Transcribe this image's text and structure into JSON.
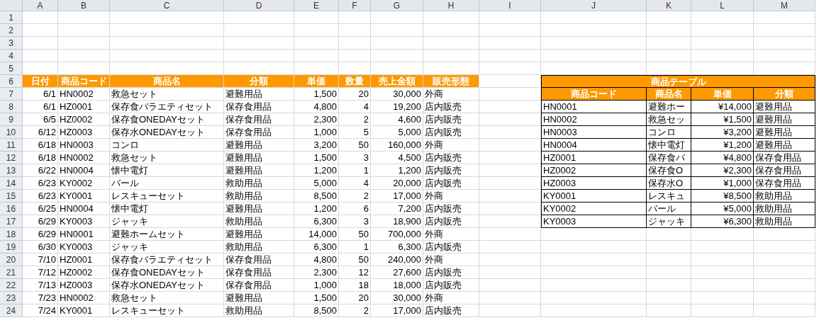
{
  "column_headers": [
    "A",
    "B",
    "C",
    "D",
    "E",
    "F",
    "G",
    "H",
    "I",
    "J",
    "K",
    "L",
    "M"
  ],
  "row_numbers": [
    "1",
    "2",
    "3",
    "4",
    "5",
    "6",
    "7",
    "8",
    "9",
    "10",
    "11",
    "12",
    "13",
    "14",
    "15",
    "16",
    "17",
    "18",
    "19",
    "20",
    "21",
    "22",
    "23",
    "24"
  ],
  "sales_table": {
    "headers": [
      "日付",
      "商品コード",
      "商品名",
      "分類",
      "単価",
      "数量",
      "売上金額",
      "販売形態"
    ],
    "rows": [
      {
        "date": "6/1",
        "code": "HN0002",
        "name": "救急セット",
        "category": "避難用品",
        "unit_price": "1,500",
        "quantity": "20",
        "amount": "30,000",
        "sales_type": "外商"
      },
      {
        "date": "6/1",
        "code": "HZ0001",
        "name": "保存食バラエティセット",
        "category": "保存食用品",
        "unit_price": "4,800",
        "quantity": "4",
        "amount": "19,200",
        "sales_type": "店内販売"
      },
      {
        "date": "6/5",
        "code": "HZ0002",
        "name": "保存食ONEDAYセット",
        "category": "保存食用品",
        "unit_price": "2,300",
        "quantity": "2",
        "amount": "4,600",
        "sales_type": "店内販売"
      },
      {
        "date": "6/12",
        "code": "HZ0003",
        "name": "保存水ONEDAYセット",
        "category": "保存食用品",
        "unit_price": "1,000",
        "quantity": "5",
        "amount": "5,000",
        "sales_type": "店内販売"
      },
      {
        "date": "6/18",
        "code": "HN0003",
        "name": "コンロ",
        "category": "避難用品",
        "unit_price": "3,200",
        "quantity": "50",
        "amount": "160,000",
        "sales_type": "外商"
      },
      {
        "date": "6/18",
        "code": "HN0002",
        "name": "救急セット",
        "category": "避難用品",
        "unit_price": "1,500",
        "quantity": "3",
        "amount": "4,500",
        "sales_type": "店内販売"
      },
      {
        "date": "6/22",
        "code": "HN0004",
        "name": "懐中電灯",
        "category": "避難用品",
        "unit_price": "1,200",
        "quantity": "1",
        "amount": "1,200",
        "sales_type": "店内販売"
      },
      {
        "date": "6/23",
        "code": "KY0002",
        "name": "バール",
        "category": "救助用品",
        "unit_price": "5,000",
        "quantity": "4",
        "amount": "20,000",
        "sales_type": "店内販売"
      },
      {
        "date": "6/23",
        "code": "KY0001",
        "name": "レスキューセット",
        "category": "救助用品",
        "unit_price": "8,500",
        "quantity": "2",
        "amount": "17,000",
        "sales_type": "外商"
      },
      {
        "date": "6/25",
        "code": "HN0004",
        "name": "懐中電灯",
        "category": "避難用品",
        "unit_price": "1,200",
        "quantity": "6",
        "amount": "7,200",
        "sales_type": "店内販売"
      },
      {
        "date": "6/29",
        "code": "KY0003",
        "name": "ジャッキ",
        "category": "救助用品",
        "unit_price": "6,300",
        "quantity": "3",
        "amount": "18,900",
        "sales_type": "店内販売"
      },
      {
        "date": "6/29",
        "code": "HN0001",
        "name": "避難ホームセット",
        "category": "避難用品",
        "unit_price": "14,000",
        "quantity": "50",
        "amount": "700,000",
        "sales_type": "外商"
      },
      {
        "date": "6/30",
        "code": "KY0003",
        "name": "ジャッキ",
        "category": "救助用品",
        "unit_price": "6,300",
        "quantity": "1",
        "amount": "6,300",
        "sales_type": "店内販売"
      },
      {
        "date": "7/10",
        "code": "HZ0001",
        "name": "保存食バラエティセット",
        "category": "保存食用品",
        "unit_price": "4,800",
        "quantity": "50",
        "amount": "240,000",
        "sales_type": "外商"
      },
      {
        "date": "7/12",
        "code": "HZ0002",
        "name": "保存食ONEDAYセット",
        "category": "保存食用品",
        "unit_price": "2,300",
        "quantity": "12",
        "amount": "27,600",
        "sales_type": "店内販売"
      },
      {
        "date": "7/13",
        "code": "HZ0003",
        "name": "保存水ONEDAYセット",
        "category": "保存食用品",
        "unit_price": "1,000",
        "quantity": "18",
        "amount": "18,000",
        "sales_type": "店内販売"
      },
      {
        "date": "7/23",
        "code": "HN0002",
        "name": "救急セット",
        "category": "避難用品",
        "unit_price": "1,500",
        "quantity": "20",
        "amount": "30,000",
        "sales_type": "外商"
      },
      {
        "date": "7/24",
        "code": "KY0001",
        "name": "レスキューセット",
        "category": "救助用品",
        "unit_price": "8,500",
        "quantity": "2",
        "amount": "17,000",
        "sales_type": "店内販売"
      }
    ]
  },
  "product_table": {
    "title": "商品テーブル",
    "headers": [
      "商品コード",
      "商品名",
      "単価",
      "分類"
    ],
    "rows": [
      {
        "code": "HN0001",
        "name": "避難ホー",
        "price": "¥14,000",
        "category": "避難用品"
      },
      {
        "code": "HN0002",
        "name": "救急セッ",
        "price": "¥1,500",
        "category": "避難用品"
      },
      {
        "code": "HN0003",
        "name": "コンロ",
        "price": "¥3,200",
        "category": "避難用品"
      },
      {
        "code": "HN0004",
        "name": "懐中電灯",
        "price": "¥1,200",
        "category": "避難用品"
      },
      {
        "code": "HZ0001",
        "name": "保存食バ",
        "price": "¥4,800",
        "category": "保存食用品"
      },
      {
        "code": "HZ0002",
        "name": "保存食O",
        "price": "¥2,300",
        "category": "保存食用品"
      },
      {
        "code": "HZ0003",
        "name": "保存水O",
        "price": "¥1,000",
        "category": "保存食用品"
      },
      {
        "code": "KY0001",
        "name": "レスキュ",
        "price": "¥8,500",
        "category": "救助用品"
      },
      {
        "code": "KY0002",
        "name": "バール",
        "price": "¥5,000",
        "category": "救助用品"
      },
      {
        "code": "KY0003",
        "name": "ジャッキ",
        "price": "¥6,300",
        "category": "救助用品"
      }
    ]
  }
}
